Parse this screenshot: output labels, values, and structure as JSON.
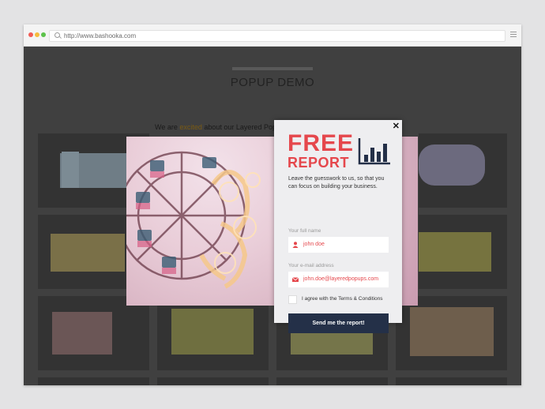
{
  "browser": {
    "url": "http://www.bashooka.com"
  },
  "page": {
    "title": "POPUP DEMO",
    "intro_before": "We are ",
    "intro_highlight": "excited",
    "intro_after": " about our Layered Pop"
  },
  "popup": {
    "close_label": "✕",
    "heading_line1": "FREE",
    "heading_line2": "REPORT",
    "description": "Leave the guesswork to us, so that you can focus on building your business.",
    "name_label": "Your full name",
    "name_value": "john doe",
    "email_label": "Your e-mail address",
    "email_value": "john.doe@layeredpopups.com",
    "terms_label": "I agree with the Terms & Conditions",
    "submit_label": "Send me the report!",
    "accent_color": "#e5474c",
    "button_color": "#243048"
  },
  "icons": {
    "chart": "bar-chart-icon",
    "user": "user-icon",
    "email": "envelope-icon",
    "search": "search-icon",
    "menu": "menu-icon"
  }
}
